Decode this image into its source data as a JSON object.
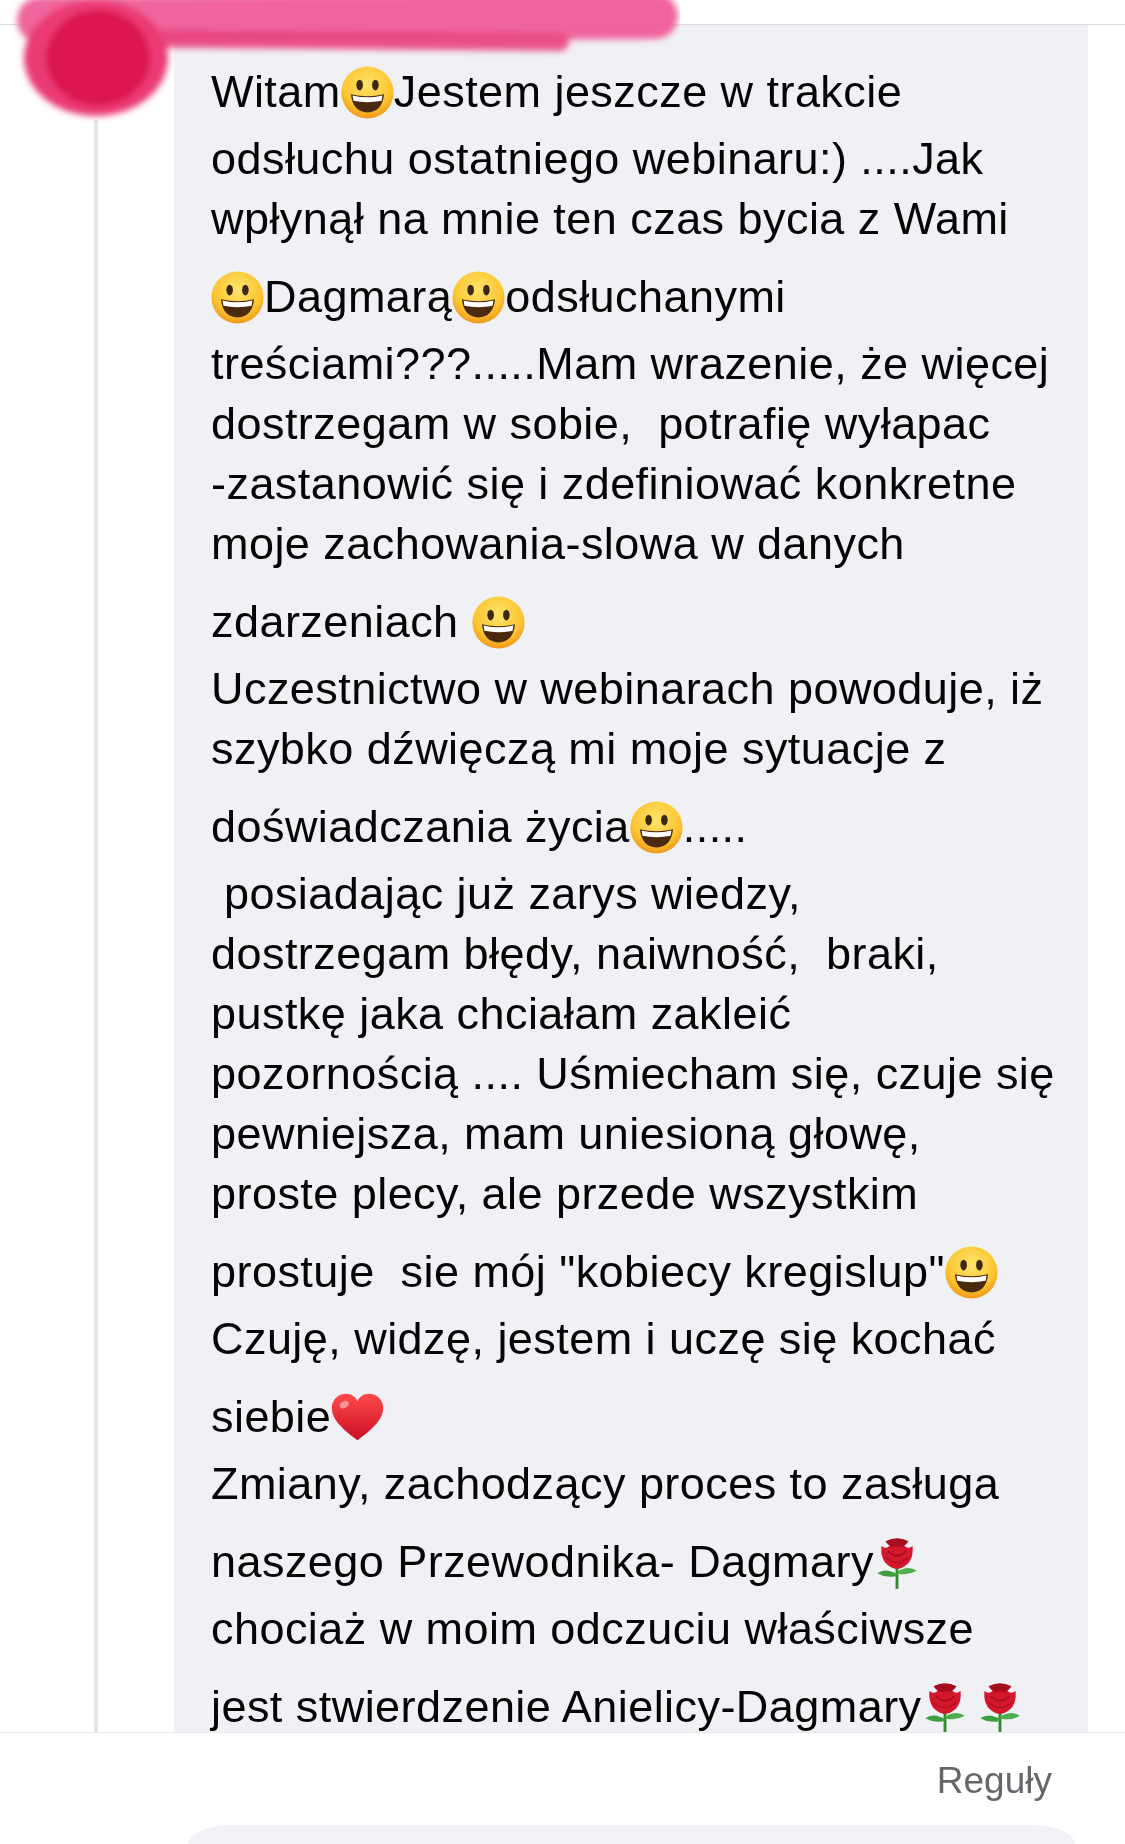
{
  "comment": {
    "lines": [
      [
        {
          "kind": "text",
          "text": "Witam"
        },
        {
          "kind": "grin"
        },
        {
          "kind": "text",
          "text": "Jestem jeszcze w trakcie"
        }
      ],
      [
        {
          "kind": "text",
          "text": "odsłuchu ostatniego webinaru:) ....Jak"
        }
      ],
      [
        {
          "kind": "text",
          "text": "wpłynął na mnie ten czas bycia z Wami"
        }
      ],
      [
        {
          "kind": "grin"
        },
        {
          "kind": "text",
          "text": "Dagmarą"
        },
        {
          "kind": "grin"
        },
        {
          "kind": "text",
          "text": "odsłuchanymi"
        }
      ],
      [
        {
          "kind": "text",
          "text": "treściami???.....Mam wrazenie, że więcej"
        }
      ],
      [
        {
          "kind": "text",
          "text": "dostrzegam w sobie,  potrafię wyłapac"
        }
      ],
      [
        {
          "kind": "text",
          "text": "-zastanowić się i zdefiniować konkretne"
        }
      ],
      [
        {
          "kind": "text",
          "text": "moje zachowania-slowa w danych"
        }
      ],
      [
        {
          "kind": "text",
          "text": "zdarzeniach "
        },
        {
          "kind": "grin"
        }
      ],
      [
        {
          "kind": "text",
          "text": "Uczestnictwo w webinarach powoduje, iż"
        }
      ],
      [
        {
          "kind": "text",
          "text": "szybko dźwięczą mi moje sytuacje z"
        }
      ],
      [
        {
          "kind": "text",
          "text": "doświadczania życia"
        },
        {
          "kind": "grin"
        },
        {
          "kind": "text",
          "text": "....."
        }
      ],
      [
        {
          "kind": "text",
          "text": " posiadając już zarys wiedzy,"
        }
      ],
      [
        {
          "kind": "text",
          "text": "dostrzegam błędy, naiwność,  braki,"
        }
      ],
      [
        {
          "kind": "text",
          "text": "pustkę jaka chciałam zakleić"
        }
      ],
      [
        {
          "kind": "text",
          "text": "pozornością .... Uśmiecham się, czuje się"
        }
      ],
      [
        {
          "kind": "text",
          "text": "pewniejsza, mam uniesioną głowę,"
        }
      ],
      [
        {
          "kind": "text",
          "text": "proste plecy, ale przede wszystkim"
        }
      ],
      [
        {
          "kind": "text",
          "text": "prostuje  sie mój \"kobiecy kregislup\""
        },
        {
          "kind": "grin"
        }
      ],
      [
        {
          "kind": "text",
          "text": "Czuję, widzę, jestem i uczę się kochać"
        }
      ],
      [
        {
          "kind": "text",
          "text": "siebie"
        },
        {
          "kind": "heart"
        }
      ],
      [
        {
          "kind": "text",
          "text": "Zmiany, zachodzący proces to zasługa"
        }
      ],
      [
        {
          "kind": "text",
          "text": "naszego Przewodnika- Dagmary"
        },
        {
          "kind": "rose"
        }
      ],
      [
        {
          "kind": "text",
          "text": "chociaż w moim odczuciu właściwsze"
        }
      ],
      [
        {
          "kind": "text",
          "text": "jest stwierdzenie Anielicy-Dagmary"
        },
        {
          "kind": "rose"
        },
        {
          "kind": "rose"
        }
      ]
    ]
  },
  "footer": {
    "rules_link": "Reguły"
  }
}
